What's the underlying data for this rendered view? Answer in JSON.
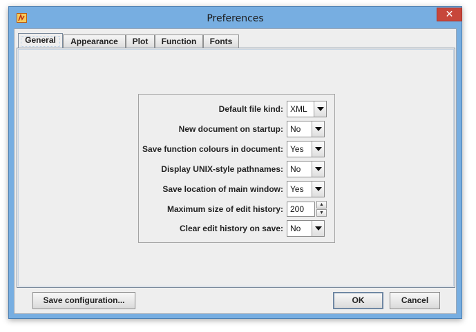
{
  "window": {
    "title": "Preferences",
    "close_glyph": "✕",
    "app_icon": "graph-app-icon"
  },
  "tabs": [
    {
      "label": "General",
      "active": true
    },
    {
      "label": "Appearance",
      "active": false
    },
    {
      "label": "Plot",
      "active": false
    },
    {
      "label": "Function",
      "active": false
    },
    {
      "label": "Fonts",
      "active": false
    }
  ],
  "settings": {
    "default_file_kind": {
      "label": "Default file kind:",
      "value": "XML"
    },
    "new_document_on_startup": {
      "label": "New document on startup:",
      "value": "No"
    },
    "save_function_colours": {
      "label": "Save function colours in document:",
      "value": "Yes"
    },
    "display_unix_pathnames": {
      "label": "Display UNIX-style pathnames:",
      "value": "No"
    },
    "save_location_main_window": {
      "label": "Save location of main window:",
      "value": "Yes"
    },
    "max_edit_history": {
      "label": "Maximum size of edit history:",
      "value": "200"
    },
    "clear_edit_history": {
      "label": "Clear edit history on save:",
      "value": "No"
    }
  },
  "buttons": {
    "save_configuration": "Save configuration...",
    "ok": "OK",
    "cancel": "Cancel"
  },
  "icons": {
    "spin_up": "▲",
    "spin_down": "▼"
  },
  "colors": {
    "window_frame": "#77aee1",
    "close_button": "#c7463a",
    "panel_background": "#eeeeee"
  }
}
